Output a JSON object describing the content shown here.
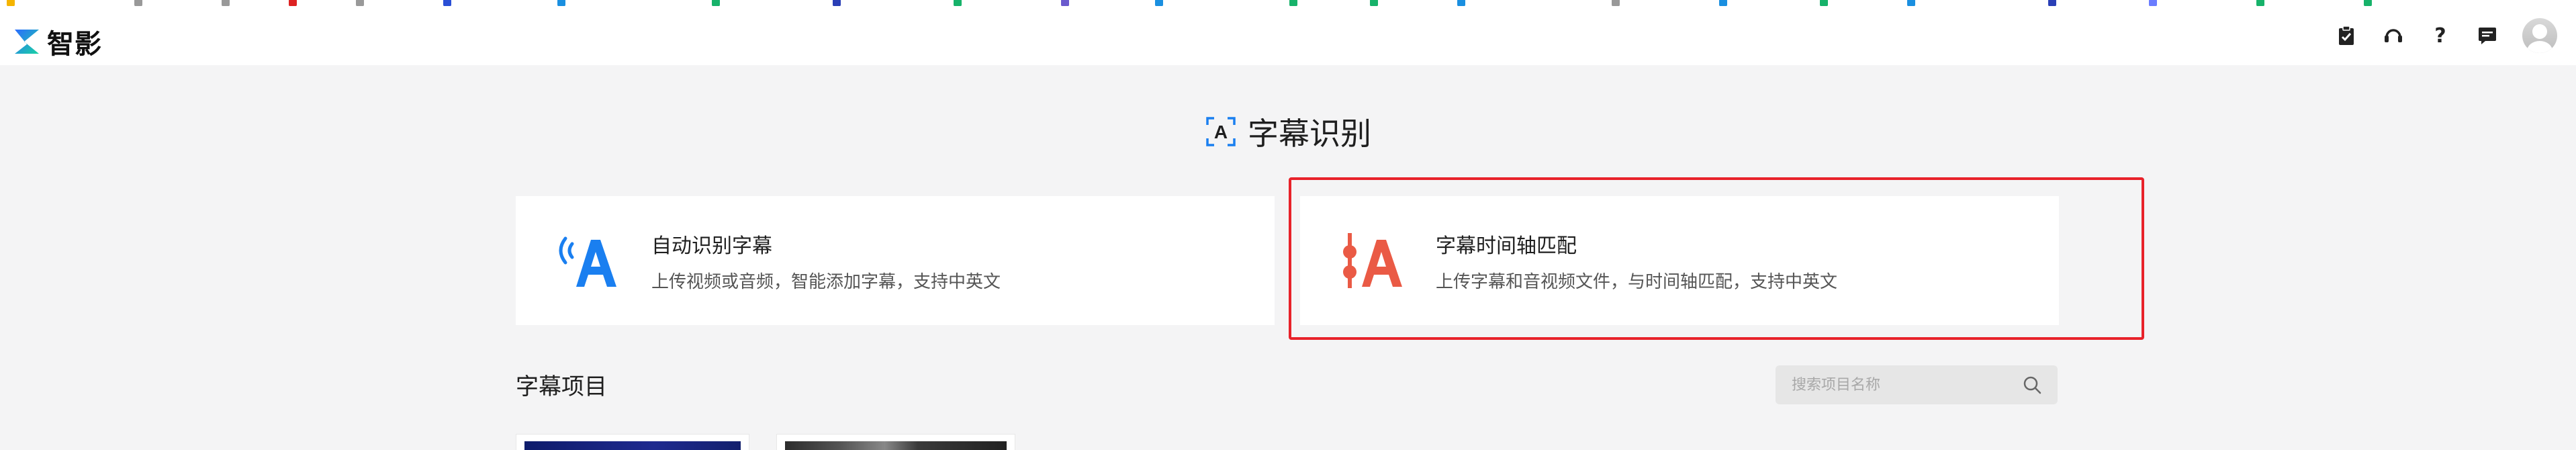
{
  "app": {
    "name": "智影"
  },
  "header": {
    "icons": [
      {
        "name": "clipboard-icon"
      },
      {
        "name": "headset-icon"
      },
      {
        "name": "help-icon"
      },
      {
        "name": "message-icon"
      }
    ]
  },
  "page": {
    "title": "字幕识别"
  },
  "cards": [
    {
      "title": "自动识别字幕",
      "desc": "上传视频或音频，智能添加字幕，支持中英文",
      "accent": "#1a7ff0",
      "icon": "voice-letter-icon"
    },
    {
      "title": "字幕时间轴匹配",
      "desc": "上传字幕和音视频文件，与时间轴匹配，支持中英文",
      "accent": "#ea5a45",
      "icon": "timeline-letter-icon"
    }
  ],
  "projects": {
    "title": "字幕项目",
    "search_placeholder": "搜索项目名称"
  },
  "colors": {
    "highlight": "#e8222a",
    "background": "#f4f4f5"
  }
}
